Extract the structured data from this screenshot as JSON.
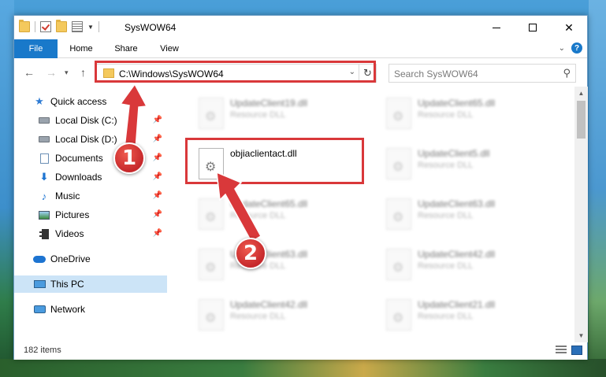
{
  "window": {
    "title": "SysWOW64",
    "minimize_glyph": "—",
    "close_glyph": "✕"
  },
  "ribbon": {
    "tabs": [
      {
        "label": "File"
      },
      {
        "label": "Home"
      },
      {
        "label": "Share"
      },
      {
        "label": "View"
      }
    ],
    "help_glyph": "?"
  },
  "address_bar": {
    "path": "C:\\Windows\\SysWOW64",
    "search_placeholder": "Search SysWOW64"
  },
  "sidebar": {
    "items": [
      {
        "label": "Quick access",
        "icon": "star-icon"
      },
      {
        "label": "Local Disk (C:)",
        "icon": "drive-icon",
        "pinned": true
      },
      {
        "label": "Local Disk (D:)",
        "icon": "drive-icon",
        "pinned": true
      },
      {
        "label": "Documents",
        "icon": "documents-icon",
        "pinned": true
      },
      {
        "label": "Downloads",
        "icon": "downloads-icon",
        "pinned": true
      },
      {
        "label": "Music",
        "icon": "music-icon",
        "pinned": true
      },
      {
        "label": "Pictures",
        "icon": "pictures-icon",
        "pinned": true
      },
      {
        "label": "Videos",
        "icon": "videos-icon",
        "pinned": true
      },
      {
        "label": "OneDrive",
        "icon": "onedrive-icon"
      },
      {
        "label": "This PC",
        "icon": "this-pc-icon",
        "selected": true
      },
      {
        "label": "Network",
        "icon": "network-icon"
      }
    ]
  },
  "files": {
    "items": [
      {
        "name": "UpdateClient19.dll",
        "type": "Resource DLL"
      },
      {
        "name": "UpdateClient65.dll",
        "type": "Resource DLL"
      },
      {
        "name": "objiaclientact.dll",
        "type": ""
      },
      {
        "name": "UpdateClient5.dll",
        "type": "Resource DLL"
      },
      {
        "name": "UpdateClient65.dll",
        "type": "Resource DLL"
      },
      {
        "name": "UpdateClient63.dll",
        "type": "Resource DLL"
      },
      {
        "name": "UpdateClient63.dll",
        "type": "Resource DLL"
      },
      {
        "name": "UpdateClient42.dll",
        "type": "Resource DLL"
      },
      {
        "name": "UpdateClient42.dll",
        "type": "Resource DLL"
      },
      {
        "name": "UpdateClient21.dll",
        "type": "Resource DLL"
      }
    ]
  },
  "status_bar": {
    "item_count": "182 items"
  },
  "annotations": {
    "markers": [
      {
        "label": "1"
      },
      {
        "label": "2"
      }
    ],
    "color": "#d9383a"
  }
}
